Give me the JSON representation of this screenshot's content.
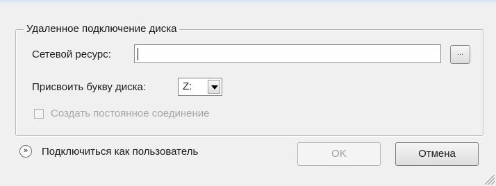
{
  "group": {
    "title": "Удаленное подключение диска"
  },
  "resource": {
    "label": "Сетевой ресурс:",
    "value": "",
    "browse_label": "..."
  },
  "drive": {
    "label": "Присвоить букву диска:",
    "value": "Z:"
  },
  "persistent": {
    "label": "Создать постоянное соединение",
    "checked": false,
    "enabled": false
  },
  "connect_as": {
    "label": "Подключиться как пользователь",
    "icon": "double-chevron-down-icon"
  },
  "buttons": {
    "ok": "OK",
    "cancel": "Отмена"
  }
}
